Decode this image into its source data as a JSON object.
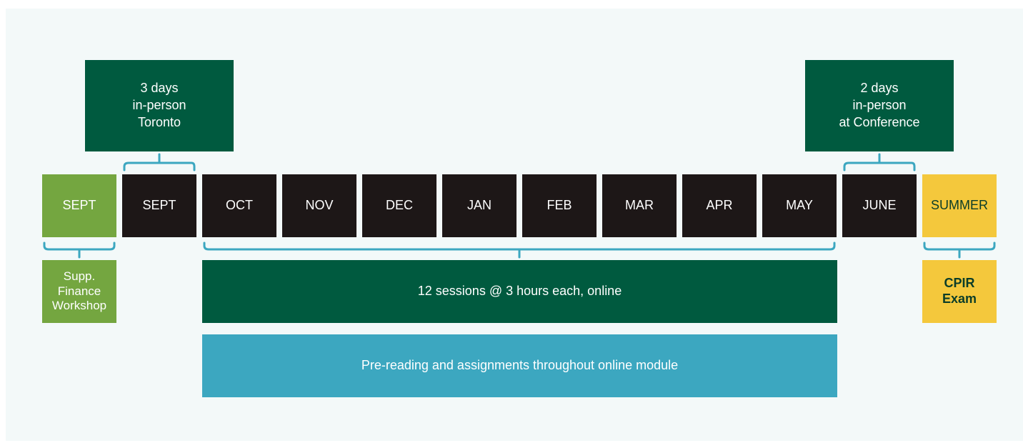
{
  "colors": {
    "background_panel": "#f3f9f9",
    "month_dark": "#1d1717",
    "dark_green": "#005a3f",
    "light_green": "#74a640",
    "yellow": "#f4c83c",
    "teal": "#3ca7c0",
    "bracket": "#3ca7c0"
  },
  "top_boxes": {
    "toronto": "3 days\nin-person\nToronto",
    "conference": "2 days\nin-person\nat Conference"
  },
  "months": [
    "SEPT",
    "SEPT",
    "OCT",
    "NOV",
    "DEC",
    "JAN",
    "FEB",
    "MAR",
    "APR",
    "MAY",
    "JUNE",
    "SUMMER"
  ],
  "bottom_boxes": {
    "workshop": "Supp.\nFinance\nWorkshop",
    "sessions": "12 sessions @ 3 hours each, online",
    "exam": "CPIR\nExam",
    "prereading": "Pre-reading and assignments throughout online module"
  }
}
